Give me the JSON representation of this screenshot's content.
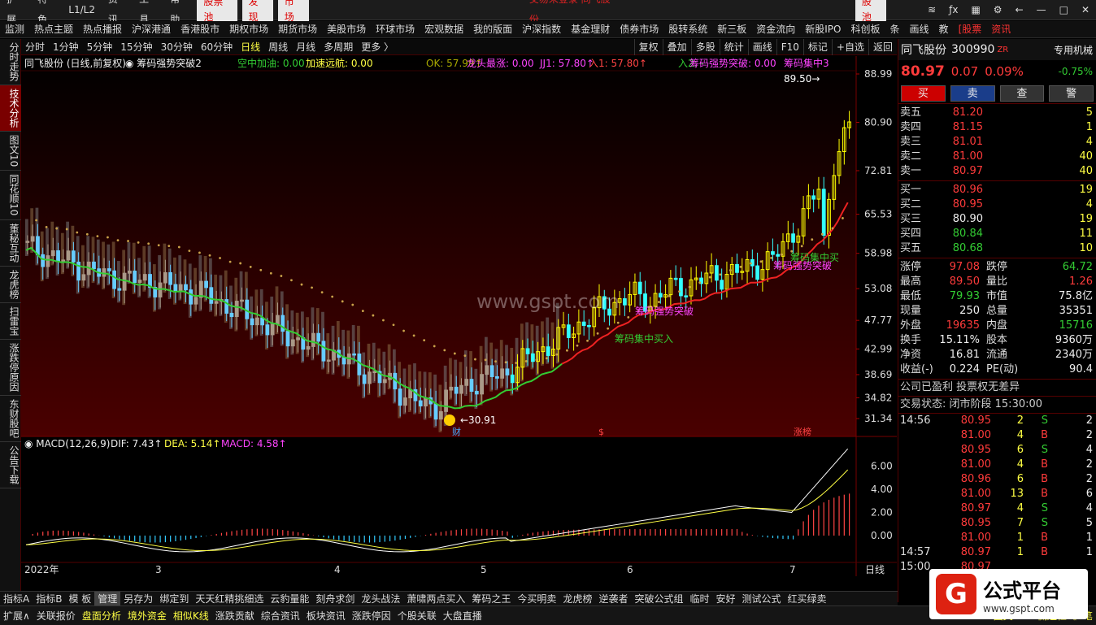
{
  "menubar": {
    "items": [
      "扩展",
      "特色",
      "L1/L2",
      "资讯",
      "工具",
      "帮助"
    ],
    "highlight": [
      "股票池",
      "发现",
      "市场"
    ],
    "center": "交易未登录  同飞股份",
    "right": "股池"
  },
  "navbar": {
    "items": [
      "监测",
      "热点主题",
      "热点播报",
      "沪深港通",
      "香港股市",
      "期权市场",
      "期货市场",
      "美股市场",
      "环球市场",
      "宏观数据",
      "我的版面",
      "沪深指数",
      "基金理财",
      "债券市场",
      "股转系统",
      "新三板",
      "资金流向",
      "新股IPO",
      "科创板",
      "条",
      "画线",
      "教",
      "[股票",
      "资讯"
    ]
  },
  "leftbar": {
    "tabs": [
      "分时走势",
      "技术分析",
      "图文10",
      "同花顺10",
      "董秘互动",
      "龙虎榜",
      "扫雷宝",
      "涨跌停原因",
      "东财股吧",
      "公告下载"
    ],
    "active": 1
  },
  "periodbar": {
    "items": [
      "分时",
      "1分钟",
      "5分钟",
      "15分钟",
      "30分钟",
      "60分钟",
      "日线",
      "周线",
      "月线",
      "多周期",
      "更多 〉"
    ],
    "active": 6,
    "right": [
      "复权",
      "叠加",
      "多股",
      "统计",
      "画线",
      "F10",
      "标记",
      "+自选",
      "返回"
    ]
  },
  "chart_header": {
    "title": "同飞股份 (日线,前复权)",
    "indicator": "筹码强势突破2",
    "items": [
      {
        "t": "空中加油: 0.00",
        "c": "#3c3"
      },
      {
        "t": "加速远航: 0.00",
        "c": "#ff4"
      },
      {
        "t": "OK: 57.99↑",
        "c": "#aa0"
      },
      {
        "t": "龙头最涨: 0.00",
        "c": "#f4f"
      },
      {
        "t": "JJ1: 57.80↑",
        "c": "#f4f"
      },
      {
        "t": "入1: 57.80↑",
        "c": "#f44"
      },
      {
        "t": "入2: -",
        "c": "#3c3"
      },
      {
        "t": "筹码强势突破: 0.00",
        "c": "#f4f"
      },
      {
        "t": "筹码集中3",
        "c": "#f4f"
      }
    ]
  },
  "price_axis": [
    "88.99",
    "80.90",
    "72.81",
    "65.53",
    "58.98",
    "53.08",
    "47.77",
    "42.99",
    "38.69",
    "34.82",
    "31.34"
  ],
  "annotations": {
    "high": "89.50",
    "low": "30.91",
    "tags": [
      "筹码强势突破",
      "筹码集中买入",
      "筹码强势突破",
      "筹码集中买"
    ],
    "marks": [
      "财",
      "$",
      "涨榜"
    ]
  },
  "macd": {
    "title": "MACD(12,26,9)",
    "dif": "DIF: 7.43↑",
    "dea": "DEA: 5.14↑",
    "macd": "MACD: 4.58↑",
    "axis": [
      "6.00",
      "4.00",
      "2.00",
      "0.00"
    ]
  },
  "time_axis": [
    "2022年",
    "3",
    "4",
    "5",
    "6",
    "7",
    "日线"
  ],
  "quote": {
    "name": "同飞股份",
    "code": "300990",
    "tag": "ZR",
    "inst": "专用机械",
    "price": "80.97",
    "change": "0.07",
    "pct": "0.09%",
    "idx_pct": "-0.75%",
    "buttons": [
      "买",
      "卖",
      "查",
      "警"
    ],
    "asks": [
      {
        "l": "卖五",
        "p": "81.20",
        "v": "5"
      },
      {
        "l": "卖四",
        "p": "81.15",
        "v": "1"
      },
      {
        "l": "卖三",
        "p": "81.01",
        "v": "4"
      },
      {
        "l": "卖二",
        "p": "81.00",
        "v": "40"
      },
      {
        "l": "卖一",
        "p": "80.97",
        "v": "40"
      }
    ],
    "bids": [
      {
        "l": "买一",
        "p": "80.96",
        "v": "19"
      },
      {
        "l": "买二",
        "p": "80.95",
        "v": "4"
      },
      {
        "l": "买三",
        "p": "80.90",
        "v": "19"
      },
      {
        "l": "买四",
        "p": "80.84",
        "v": "11"
      },
      {
        "l": "买五",
        "p": "80.68",
        "v": "10"
      }
    ],
    "stats": [
      [
        "涨停",
        "97.08",
        "跌停",
        "64.72"
      ],
      [
        "最高",
        "89.50",
        "量比",
        "1.26"
      ],
      [
        "最低",
        "79.93",
        "市值",
        "75.8亿"
      ],
      [
        "现量",
        "250",
        "总量",
        "35351"
      ],
      [
        "外盘",
        "19635",
        "内盘",
        "15716"
      ],
      [
        "换手",
        "15.11%",
        "股本",
        "9360万"
      ],
      [
        "净资",
        "16.81",
        "流通",
        "2340万"
      ],
      [
        "收益(-)",
        "0.224",
        "PE(动)",
        "90.4"
      ]
    ],
    "note1": "公司已盈利 投票权无差异",
    "note2": "交易状态: 闭市阶段 15:30:00",
    "ticks": [
      {
        "t": "14:56",
        "p": "80.95",
        "v": "2",
        "s": "S",
        "n": "2"
      },
      {
        "t": "",
        "p": "81.00",
        "v": "4",
        "s": "B",
        "n": "2"
      },
      {
        "t": "",
        "p": "80.95",
        "v": "6",
        "s": "S",
        "n": "4"
      },
      {
        "t": "",
        "p": "81.00",
        "v": "4",
        "s": "B",
        "n": "2"
      },
      {
        "t": "",
        "p": "80.96",
        "v": "6",
        "s": "B",
        "n": "2"
      },
      {
        "t": "",
        "p": "81.00",
        "v": "13",
        "s": "B",
        "n": "6"
      },
      {
        "t": "",
        "p": "80.97",
        "v": "4",
        "s": "S",
        "n": "4"
      },
      {
        "t": "",
        "p": "80.95",
        "v": "7",
        "s": "S",
        "n": "5"
      },
      {
        "t": "",
        "p": "81.00",
        "v": "1",
        "s": "B",
        "n": "1"
      },
      {
        "t": "14:57",
        "p": "80.97",
        "v": "1",
        "s": "B",
        "n": "1"
      },
      {
        "t": "15:00",
        "p": "80.97",
        "v": "",
        "s": "",
        "n": ""
      }
    ]
  },
  "bottombar": {
    "items": [
      "指标A",
      "指标B",
      "模 板",
      "管理",
      "另存为",
      "绑定到",
      "天天红精挑细选",
      "云豹量能",
      "刻舟求剑",
      "龙头战法",
      "萧啸两点买入",
      "筹码之王",
      "今买明卖",
      "龙虎榜",
      "逆袭者",
      "突破公式组",
      "临时",
      "安好",
      "测试公式",
      "红买绿卖"
    ]
  },
  "statusbar": {
    "items": [
      "扩展∧",
      "关联报价",
      "盘面分析",
      "境外资金",
      "相似K线",
      "涨跌贡献",
      "综合资讯",
      "板块资讯",
      "涨跌停因",
      "个股关联",
      "大盘直播"
    ],
    "right": [
      "图文F10",
      "侧边栏《",
      "笔"
    ]
  },
  "watermark": {
    "domain": "www.gspt.com",
    "brand": "公式平台",
    "url": "www.gspt.com"
  }
}
